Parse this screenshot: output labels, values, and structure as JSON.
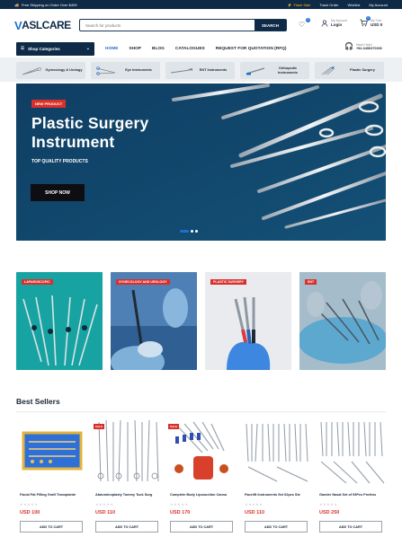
{
  "topbar": {
    "shipping": "Free Shipping on Order Over $499",
    "links": [
      "Flash Sale",
      "Track Order",
      "Wishlist",
      "My Account"
    ]
  },
  "header": {
    "logo_mark": "V",
    "logo_text": "ASLCARE",
    "search_placeholder": "Search for products",
    "search_button": "SEARCH",
    "wishlist_count": "0",
    "account_small": "My Account",
    "account_label": "Login",
    "cart_count": "0",
    "cart_small": "My Cart",
    "cart_total": "USD 0"
  },
  "nav": {
    "categories_label": "Shop Categories",
    "menu": [
      "HOME",
      "SHOP",
      "BLOG",
      "CATALOGUES",
      "REQUEST FOR QUOTATION (RFQ)"
    ],
    "support_small": "Need Help?",
    "support_phone": "+92-3456370300"
  },
  "category_strip": [
    {
      "label": "Gynecology & Urology"
    },
    {
      "label": "Eye Instruments"
    },
    {
      "label": "ENT Instruments"
    },
    {
      "label": "Orthopedic Instruments"
    },
    {
      "label": "Plastic Surgery"
    }
  ],
  "hero": {
    "tag": "NEW PRODUCT",
    "title_line1": "Plastic Surgery",
    "title_line2": "Instrument",
    "subtitle": "TOP QUALITY PRODUCTS",
    "cta": "SHOP NOW",
    "slide_dots": 3
  },
  "tiles": [
    {
      "tag": "LAPAROSCOPIC",
      "bg": "#1aa9a6"
    },
    {
      "tag": "GYNECOLOGY AND UROLOGY",
      "bg": "#5f8fc0"
    },
    {
      "tag": "PLASTIC SURGERY",
      "bg": "#e6e8ec"
    },
    {
      "tag": "ENT",
      "bg": "#9fb8c6"
    }
  ],
  "best_sellers": {
    "title": "Best Sellers",
    "products": [
      {
        "name": "Facial Fat Filling Graft Transplante",
        "price": "USD 100",
        "sale": "",
        "stars": "★★★★★",
        "cta": "ADD TO CART"
      },
      {
        "name": "Abdominoplasty Tummy Tuck Surg",
        "price": "USD 110",
        "sale": "SALE",
        "stars": "★★★★★",
        "cta": "ADD TO CART"
      },
      {
        "name": "Complete Body Liposuction Cannu",
        "price": "USD 170",
        "sale": "SALE",
        "stars": "★★★★★",
        "cta": "ADD TO CART"
      },
      {
        "name": "Facelift Instruments Set 62pcs Ste",
        "price": "USD 110",
        "sale": "",
        "stars": "★★★★★",
        "cta": "ADD TO CART"
      },
      {
        "name": "Gander Nasal Set of 93Pcs Profess",
        "price": "USD 250",
        "sale": "",
        "stars": "★★★★★",
        "cta": "ADD TO CART"
      }
    ]
  },
  "colors": {
    "navy": "#0e2a47",
    "accent_blue": "#1d6fd0",
    "sale_red": "#d9302b",
    "hero_bg": "#11456a"
  }
}
